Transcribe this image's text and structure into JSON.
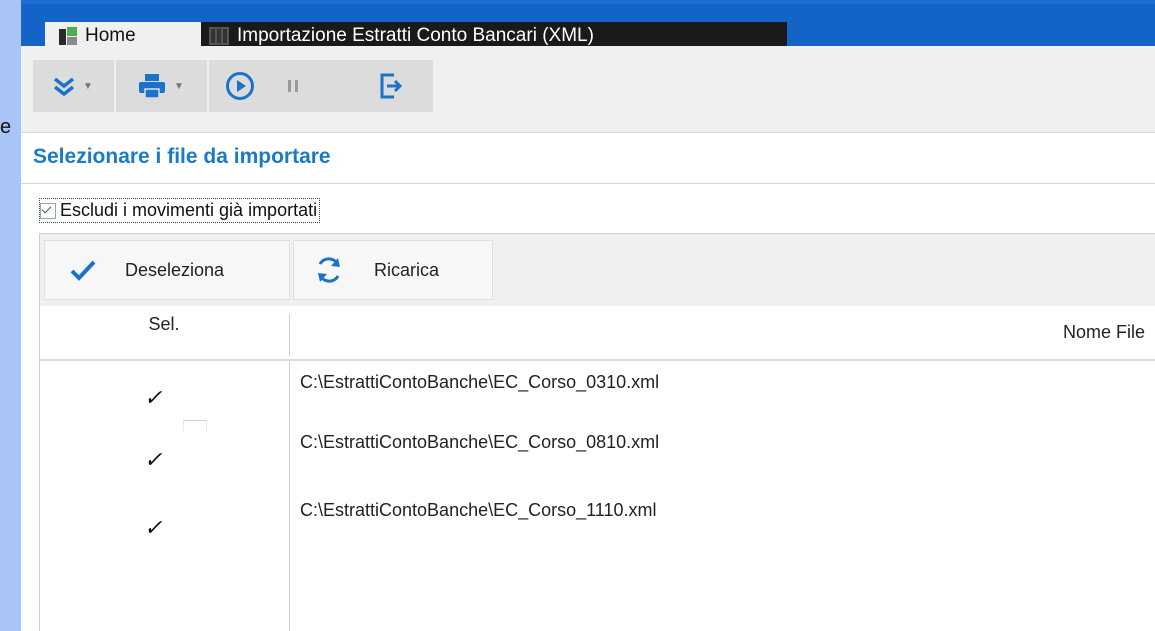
{
  "stray_text": "e",
  "tabs": [
    {
      "label": "Home",
      "icon": "home-icon"
    },
    {
      "label": "Importazione Estratti Conto Bancari (XML)",
      "icon": "window-icon"
    }
  ],
  "toolbar": {
    "buttons": [
      {
        "icon": "expand-chevrons-icon",
        "has_dropdown": true
      },
      {
        "icon": "printer-icon",
        "has_dropdown": true
      },
      {
        "icon": "play-icon"
      },
      {
        "icon": "pause-icon"
      },
      {
        "icon": "export-icon"
      }
    ],
    "accent_color": "#1a73c9"
  },
  "section": {
    "title": "Selezionare i file da importare"
  },
  "options": {
    "exclude_imported": {
      "label": "Escludi i movimenti già importati",
      "checked": true
    }
  },
  "actions": {
    "deselect_label": "Deseleziona",
    "reload_label": "Ricarica"
  },
  "grid": {
    "columns": [
      "Sel.",
      "Nome File"
    ],
    "rows": [
      {
        "selected": true,
        "tick": "✓",
        "file": "C:\\EstrattiContoBanche\\EC_Corso_0310.xml"
      },
      {
        "selected": true,
        "tick": "✓",
        "file": "C:\\EstrattiContoBanche\\EC_Corso_0810.xml"
      },
      {
        "selected": true,
        "tick": "✓",
        "file": "C:\\EstrattiContoBanche\\EC_Corso_1110.xml"
      }
    ]
  },
  "colors": {
    "tab_bar": "#1464c8",
    "title_blue": "#1a7cc7",
    "page_background": "#a9c5f5"
  }
}
